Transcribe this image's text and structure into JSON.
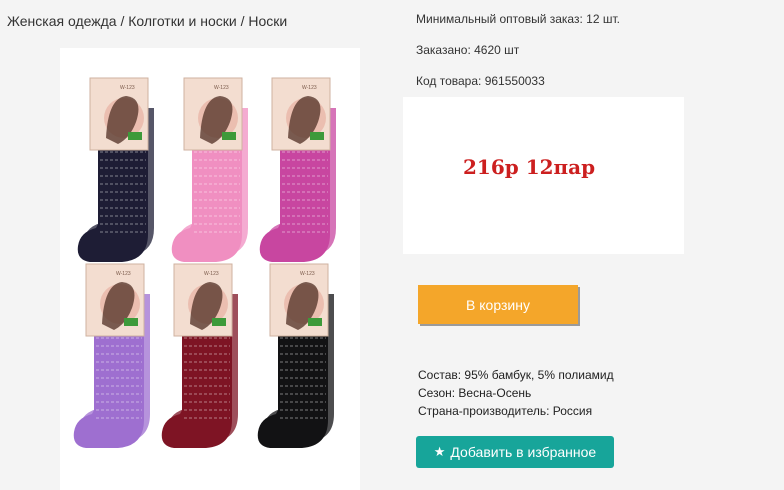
{
  "breadcrumb": "Женская одежда / Колготки и носки / Носки",
  "product": {
    "min_order": "Минимальный оптовый заказ: 12 шт.",
    "ordered": "Заказано: 4620 шт",
    "sku": "Код товара: 961550033",
    "price": "216р 12пар",
    "cart_button": "В корзину",
    "composition": "Состав: 95% бамбук, 5% полиамид",
    "season": "Сезон: Весна-Осень",
    "country": "Страна-производитель: Россия",
    "favorite_button": "Добавить в избранное",
    "favorite_icon": "star-icon"
  },
  "image": {
    "label_text": "W-123",
    "sock_colors": [
      "#1e1d35",
      "#f08fc1",
      "#c846a0",
      "#9e6fd0",
      "#7e1424",
      "#121214"
    ]
  },
  "colors": {
    "price": "#cc1f1f",
    "cart_button": "#f4a62a",
    "favorite_button": "#17a59a"
  }
}
